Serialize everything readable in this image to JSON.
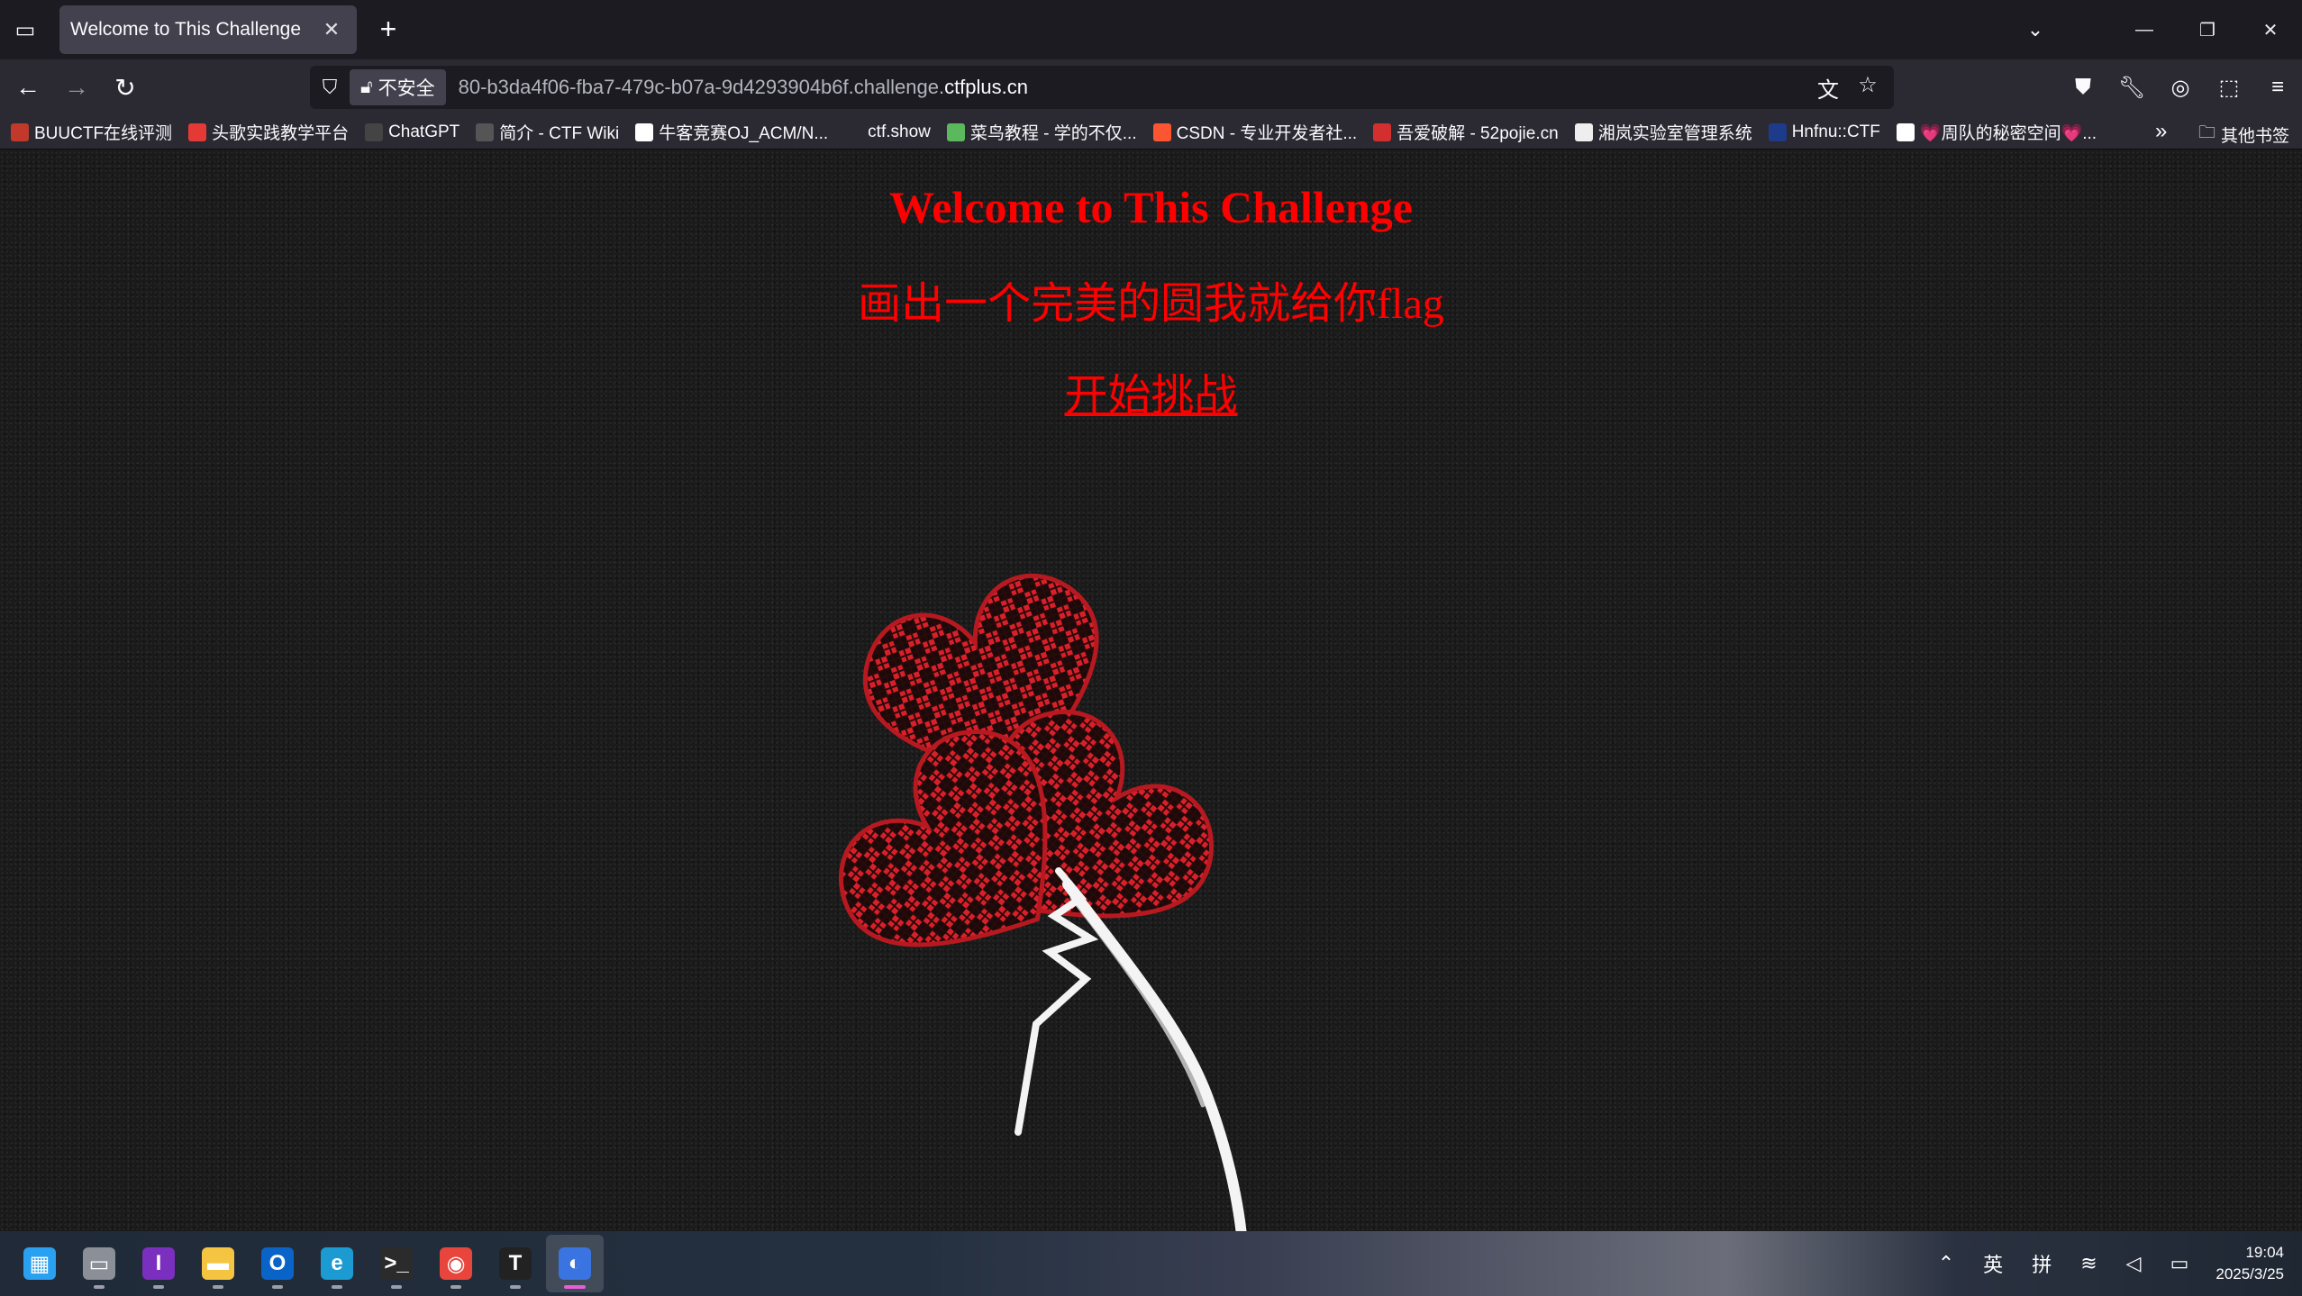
{
  "browser": {
    "tab": {
      "title": "Welcome to This Challenge",
      "close_glyph": "✕"
    },
    "new_tab_glyph": "+",
    "url_bar": {
      "security_label": "不安全",
      "url_prefix": "80-b3da4f06-fba7-479c-b07a-9d4293904b6f.challenge.",
      "url_host": "ctfplus.cn"
    },
    "bookmarks": [
      {
        "label": "BUUCTF在线评测",
        "color": "#c0392b"
      },
      {
        "label": "头歌实践教学平台",
        "color": "#e53935"
      },
      {
        "label": "ChatGPT",
        "color": "#444444"
      },
      {
        "label": "简介 - CTF Wiki",
        "color": "#555555"
      },
      {
        "label": "牛客竞赛OJ_ACM/N...",
        "color": "#ffffff"
      },
      {
        "label": "ctf.show",
        "color": "#2b2a33"
      },
      {
        "label": "菜鸟教程 - 学的不仅...",
        "color": "#5cb85c"
      },
      {
        "label": "CSDN - 专业开发者社...",
        "color": "#fc5531"
      },
      {
        "label": "吾爱破解 - 52pojie.cn",
        "color": "#d32f2f"
      },
      {
        "label": "湘岚实验室管理系统",
        "color": "#eeeeee"
      },
      {
        "label": "Hnfnu::CTF",
        "color": "#1e3a8a"
      },
      {
        "label": "💗周队的秘密空间💗...",
        "color": "#ffffff"
      }
    ],
    "other_bookmarks": "其他书签"
  },
  "page": {
    "title": "Welcome to This Challenge",
    "subtitle": "画出一个完美的圆我就给你flag",
    "start_link": "开始挑战"
  },
  "taskbar": {
    "apps": [
      {
        "name": "windows-start-icon",
        "glyph": "▦",
        "color": "#2aa0f0"
      },
      {
        "name": "file-manager-icon",
        "glyph": "▭",
        "color": "#8a8f98"
      },
      {
        "name": "ide-icon",
        "glyph": "I",
        "color": "#7b2fbe"
      },
      {
        "name": "folder-icon",
        "glyph": "▬",
        "color": "#f5c542"
      },
      {
        "name": "outlook-icon",
        "glyph": "O",
        "color": "#0a64c8"
      },
      {
        "name": "edge-icon",
        "glyph": "e",
        "color": "#1b9bd1"
      },
      {
        "name": "terminal-icon",
        "glyph": ">_",
        "color": "#2b2b2b"
      },
      {
        "name": "chrome-icon",
        "glyph": "◉",
        "color": "#e8453c"
      },
      {
        "name": "typora-icon",
        "glyph": "T",
        "color": "#222222"
      },
      {
        "name": "firefox-icon",
        "glyph": "◐",
        "color": "#3a74e0"
      }
    ],
    "ime_lang": "英",
    "ime_mode": "拼",
    "time": "19:04",
    "date": "2025/3/25"
  }
}
